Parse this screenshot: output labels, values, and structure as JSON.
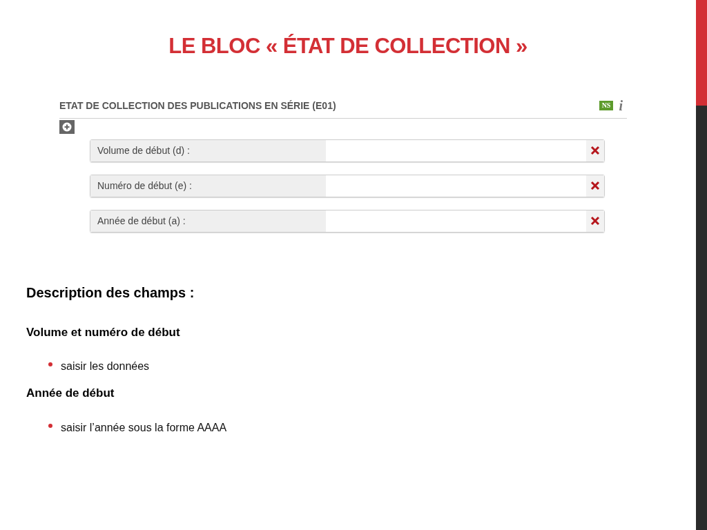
{
  "title": "LE BLOC « ÉTAT DE COLLECTION »",
  "form": {
    "heading": "ETAT DE COLLECTION DES PUBLICATIONS EN SÉRIE (E01)",
    "badge": "NS",
    "info": "i",
    "fields": [
      {
        "label": "Volume de début (d) :"
      },
      {
        "label": "Numéro de début (e) :"
      },
      {
        "label": "Année de début (a) :"
      }
    ]
  },
  "description": {
    "heading": "Description des champs :",
    "groups": [
      {
        "heading": "Volume et numéro de début",
        "bullets": [
          "saisir les données"
        ]
      },
      {
        "heading": "Année de début",
        "bullets": [
          "saisir l’année sous la forme AAAA"
        ]
      }
    ]
  }
}
